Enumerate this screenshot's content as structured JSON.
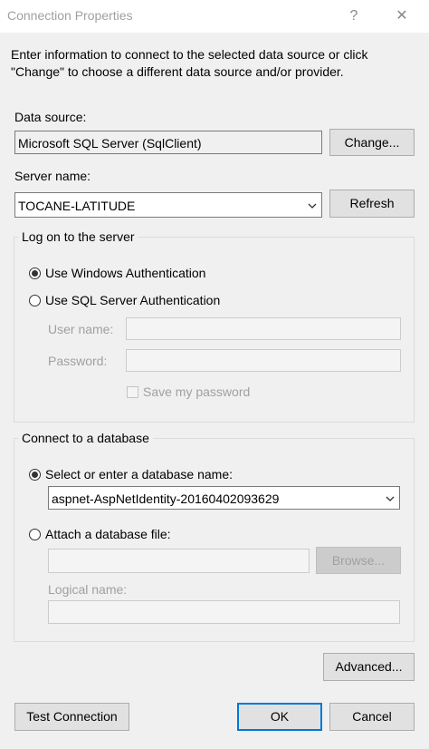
{
  "window": {
    "title": "Connection Properties",
    "help_glyph": "?",
    "close_glyph": "✕"
  },
  "intro": {
    "line1": "Enter information to connect to the selected data source or click",
    "line2": "\"Change\" to choose a different data source and/or provider."
  },
  "data_source": {
    "label": "Data source:",
    "value": "Microsoft SQL Server (SqlClient)",
    "change_button": "Change..."
  },
  "server": {
    "label": "Server name:",
    "value": "TOCANE-LATITUDE",
    "refresh_button": "Refresh"
  },
  "logon": {
    "group_label": "Log on to the server",
    "windows_auth": "Use Windows Authentication",
    "sql_auth": "Use SQL Server Authentication",
    "selected": "windows",
    "user_name_label": "User name:",
    "user_name_value": "",
    "password_label": "Password:",
    "password_value": "",
    "save_password": "Save my password"
  },
  "database": {
    "group_label": "Connect to a database",
    "select_option": "Select or enter a database name:",
    "database_name": "aspnet-AspNetIdentity-20160402093629",
    "attach_option": "Attach a database file:",
    "attach_value": "",
    "browse_button": "Browse...",
    "logical_name_label": "Logical name:",
    "logical_name_value": "",
    "selected": "select"
  },
  "footer": {
    "advanced_button": "Advanced...",
    "test_button": "Test Connection",
    "ok_button": "OK",
    "cancel_button": "Cancel"
  }
}
